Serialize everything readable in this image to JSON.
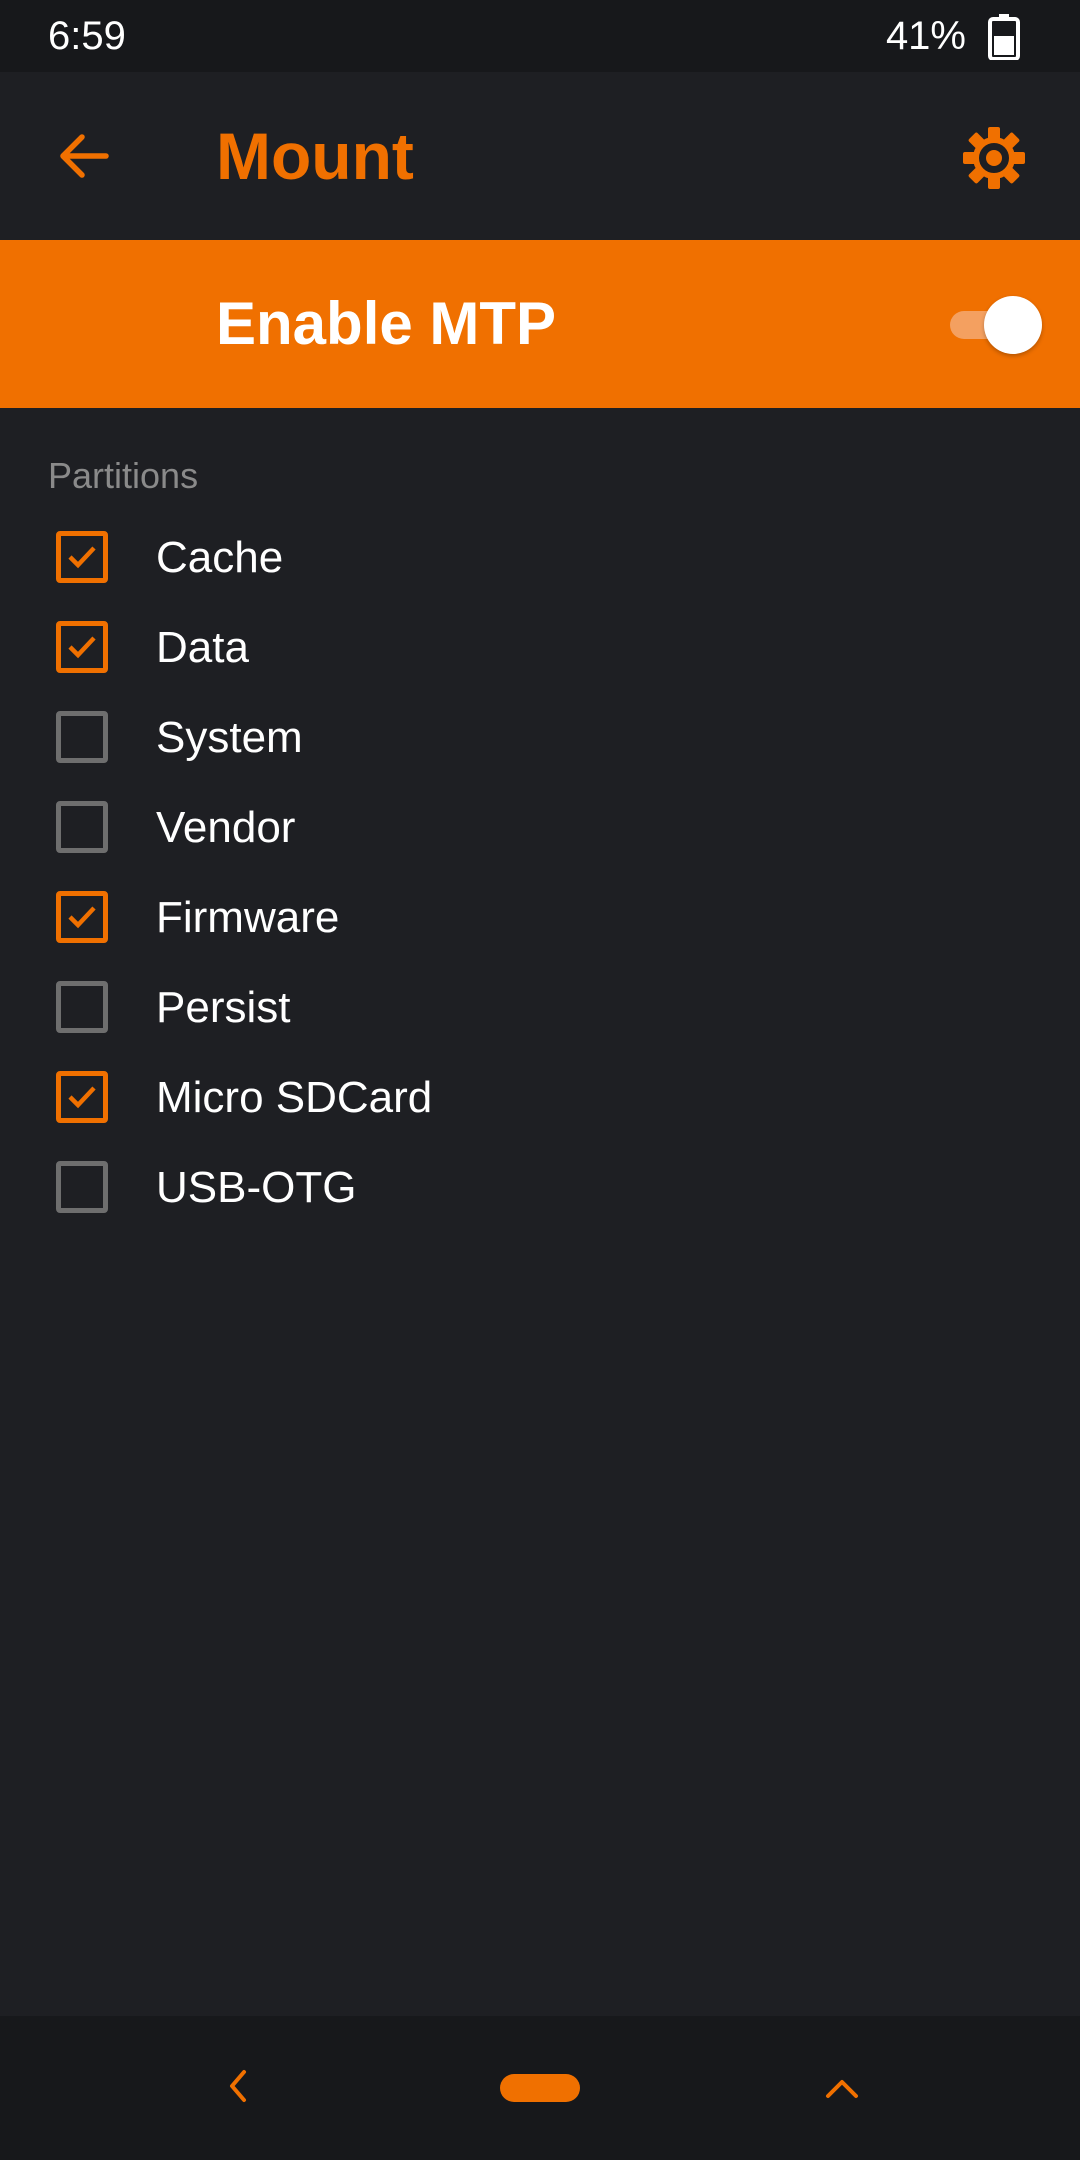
{
  "status_bar": {
    "time": "6:59",
    "battery": "41%"
  },
  "app_bar": {
    "title": "Mount"
  },
  "mtp": {
    "label": "Enable MTP",
    "enabled": true
  },
  "partitions": {
    "header": "Partitions",
    "items": [
      {
        "label": "Cache",
        "checked": true
      },
      {
        "label": "Data",
        "checked": true
      },
      {
        "label": "System",
        "checked": false
      },
      {
        "label": "Vendor",
        "checked": false
      },
      {
        "label": "Firmware",
        "checked": true
      },
      {
        "label": "Persist",
        "checked": false
      },
      {
        "label": "Micro SDCard",
        "checked": true
      },
      {
        "label": "USB-OTG",
        "checked": false
      }
    ]
  },
  "colors": {
    "accent": "#f07000",
    "background": "#1e1f23",
    "bar_dark": "#17181b",
    "muted": "#8a8a8a"
  },
  "icons": {
    "back": "arrow-left-icon",
    "settings": "gear-icon",
    "battery": "battery-icon",
    "nav_back": "chevron-left-icon",
    "nav_recents": "chevron-up-icon"
  }
}
